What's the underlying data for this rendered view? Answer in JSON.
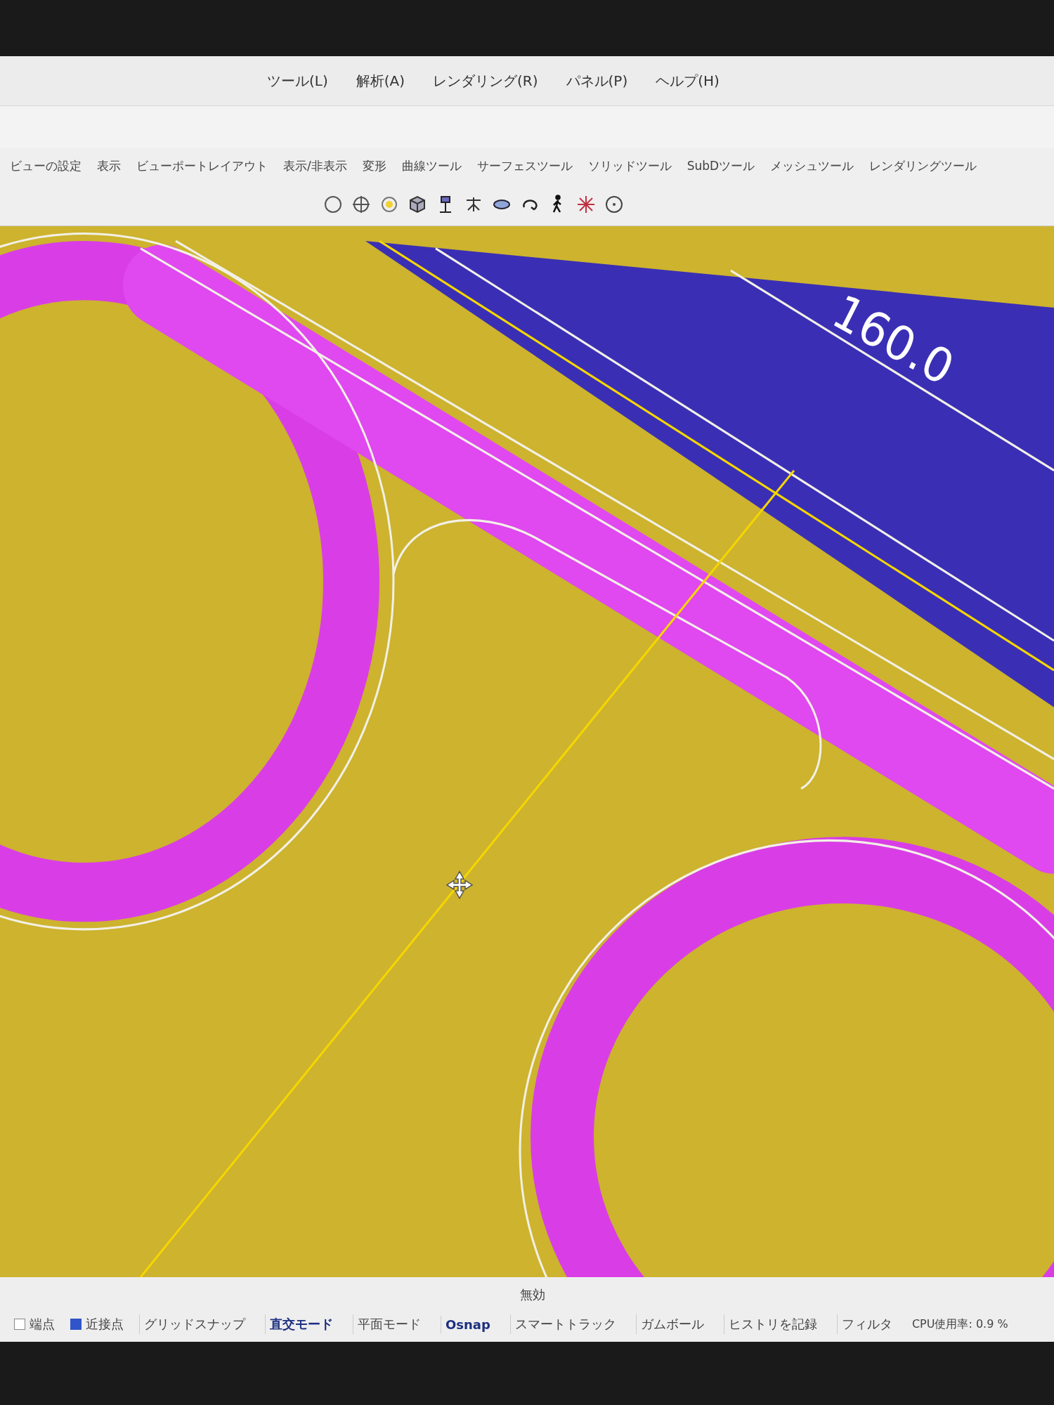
{
  "menu_bar": {
    "items": [
      "ツール(L)",
      "解析(A)",
      "レンダリング(R)",
      "パネル(P)",
      "ヘルプ(H)"
    ]
  },
  "toolbar_tabs": [
    {
      "label": "ビューの設定",
      "selected": false
    },
    {
      "label": "表示",
      "selected": false
    },
    {
      "label": "ビューポートレイアウト",
      "selected": false
    },
    {
      "label": "表示/非表示",
      "selected": false
    },
    {
      "label": "変形",
      "selected": false
    },
    {
      "label": "曲線ツール",
      "selected": false
    },
    {
      "label": "サーフェスツール",
      "selected": false
    },
    {
      "label": "ソリッドツール",
      "selected": false
    },
    {
      "label": "SubDツール",
      "selected": false
    },
    {
      "label": "メッシュツール",
      "selected": false
    },
    {
      "label": "レンダリングツール",
      "selected": false
    }
  ],
  "viewport": {
    "dimension_label": "160.0"
  },
  "status_bar": {
    "snap_state": "無効",
    "snaps": [
      {
        "label": "端点",
        "checked": false
      },
      {
        "label": "近接点",
        "checked": true
      }
    ],
    "toggles": [
      {
        "label": "グリッドスナップ",
        "on": false
      },
      {
        "label": "直交モード",
        "on": true
      },
      {
        "label": "平面モード",
        "on": false
      },
      {
        "label": "Osnap",
        "on": true
      },
      {
        "label": "スマートトラック",
        "on": false
      },
      {
        "label": "ガムボール",
        "on": false
      },
      {
        "label": "ヒストリを記録",
        "on": false
      },
      {
        "label": "フィルタ",
        "on": false
      }
    ],
    "cpu": "CPU使用率: 0.9 %"
  }
}
